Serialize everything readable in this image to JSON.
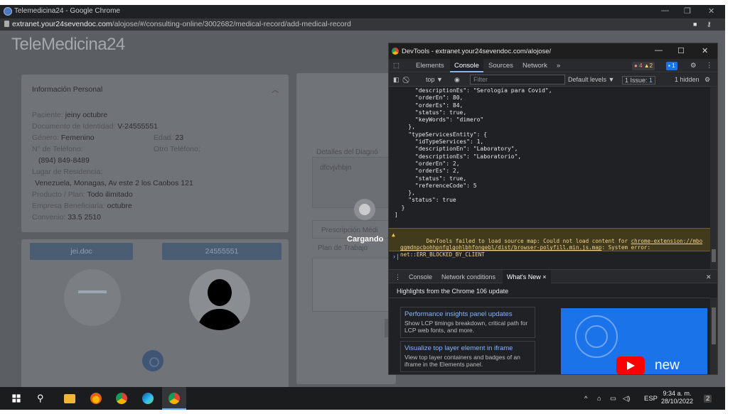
{
  "window": {
    "title": "Telemedicina24 - Google Chrome",
    "minimize": "—",
    "maximize": "❐",
    "close": "✕"
  },
  "address_bar": {
    "host": "extranet.your24sevendoc.com",
    "path": "/alojose/#/consulting-online/3002682/medical-record/add-medical-record"
  },
  "site": {
    "logo": "TeleMedicina24",
    "personal_info": {
      "header": "Información Personal",
      "collapse_icon": "chevron-up-icon",
      "patient_label": "Paciente:",
      "patient_value": "jeiny octubre",
      "id_label": "Documento de Identidad:",
      "id_value": "V-24555551",
      "gender_label": "Género:",
      "gender_value": "Femenino",
      "age_label": "Edad:",
      "age_value": "23",
      "phone_label": "N° de Teléfono:",
      "phone_value": "(894) 849-8489",
      "other_phone_label": "Otro Teléfono:",
      "residence_label": "Lugar de Residencia:",
      "residence_value": "Venezuela, Monagas, Av este 2 los Caobos 121",
      "product_label": "Producto / Plan:",
      "product_value": "Todo ilimitado",
      "company_label": "Empresa Beneficiaria:",
      "company_value": "octubre",
      "agreement_label": "Convenio:",
      "agreement_value": "33.5 2510"
    },
    "doc_pill": "jei.doc",
    "id_pill": "24555551",
    "right_panel": {
      "diagnosis_label": "Detalles del Diagnó",
      "diagnosis_text": "dfcvjvhbjn",
      "prescription_placeholder": "Prescripción Médi",
      "plan_label": "Plan de Trabajo"
    },
    "loading_text": "Cargando"
  },
  "devtools": {
    "title": "DevTools - extranet.your24sevendoc.com/alojose/",
    "tabs": [
      "Elements",
      "Console",
      "Sources",
      "Network"
    ],
    "active_tab": "Console",
    "more_tabs": "»",
    "errors_count": "4",
    "warnings_count": "2",
    "messages_count": "1",
    "context": "top ▼",
    "filter_placeholder": "Filter",
    "levels": "Default levels ▼",
    "issues": "1 Issue: ",
    "issues_count": "1",
    "hidden": "1 hidden",
    "console_lines": [
      "      \"descriptionEs\": \"Serología para Covid\",",
      "      \"orderEn\": 80,",
      "      \"orderEs\": 84,",
      "      \"status\": true,",
      "      \"keyWords\": \"dimero\"",
      "    },",
      "    \"typeServicesEntity\": {",
      "      \"idTypeServices\": 1,",
      "      \"descriptionEn\": \"Laboratory\",",
      "      \"descriptionEs\": \"Laboratorio\",",
      "      \"orderEn\": 2,",
      "      \"orderEs\": 2,",
      "      \"status\": true,",
      "      \"referenceCode\": 5",
      "    },",
      "    \"status\": true",
      "  }",
      "]"
    ],
    "warning_prefix": "DevTools failed to load source map: Could not load content for ",
    "warning_link": "chrome-extension://mbo\nggmdnpcbohhpnfglgohlbhfongebl/dist/browser-polyfill.min.js.map",
    "warning_suffix": ": System error:\nnet::ERR_BLOCKED_BY_CLIENT",
    "prompt": "› |",
    "drawer_tabs": [
      "Console",
      "Network conditions",
      "What's New ×"
    ],
    "drawer_active": "What's New ×",
    "highlights": "Highlights from the Chrome 106 update",
    "features": [
      {
        "title": "Performance insights panel updates",
        "desc": "Show LCP timings breakdown, critical path for LCP web fonts, and more."
      },
      {
        "title": "Visualize top layer element in iframe",
        "desc": "View top layer containers and badges of an iframe in the Elements panel."
      }
    ],
    "video_label": "new"
  },
  "taskbar": {
    "clock_time": "9:34 a. m.",
    "clock_date": "28/10/2022",
    "language": "ESP",
    "notification_count": "2"
  },
  "colors": {
    "page_overlay": "#5b5e62",
    "devtools_bg": "#202124",
    "accent_blue": "#8ab4f8",
    "warning_bg": "#413a1c"
  }
}
